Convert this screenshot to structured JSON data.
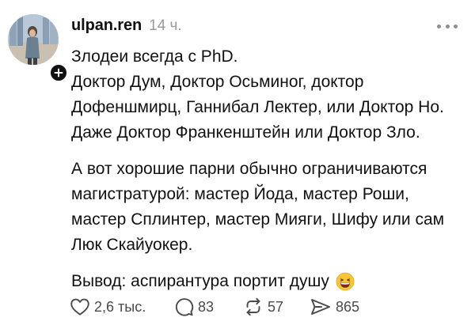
{
  "post": {
    "username": "ulpan.ren",
    "time": "14 ч.",
    "paragraphs": {
      "p1": [
        "Злодеи всегда с PhD.",
        "Доктор Дум, Доктор Осьминог, доктор",
        "Дофеншмирц, Ганнибал Лектер, или Доктор Но.",
        "Даже Доктор Франкенштейн или Доктор Зло."
      ],
      "p2": [
        "А вот хорошие парни обычно ограничиваются",
        "магистратурой: мастер Йода, мастер Роши,",
        "мастер Сплинтер, мастер Мияги, Шифу или сам",
        "Люк Скайуокер."
      ],
      "p3": "Вывод: аспирантура портит душу"
    },
    "emoji": "grinning-squinting-face",
    "stats": {
      "likes": "2,6 тыс.",
      "comments": "83",
      "reposts": "57",
      "shares": "865"
    }
  },
  "icons": {
    "follow": "plus-icon",
    "more": "ellipsis-icon",
    "like": "heart-icon",
    "comment": "comment-bubble-icon",
    "repost": "repost-arrows-icon",
    "share": "send-icon"
  },
  "colors": {
    "text": "#111111",
    "muted": "#9a9a9a",
    "icon": "#4a4a4a",
    "background": "#ffffff"
  }
}
